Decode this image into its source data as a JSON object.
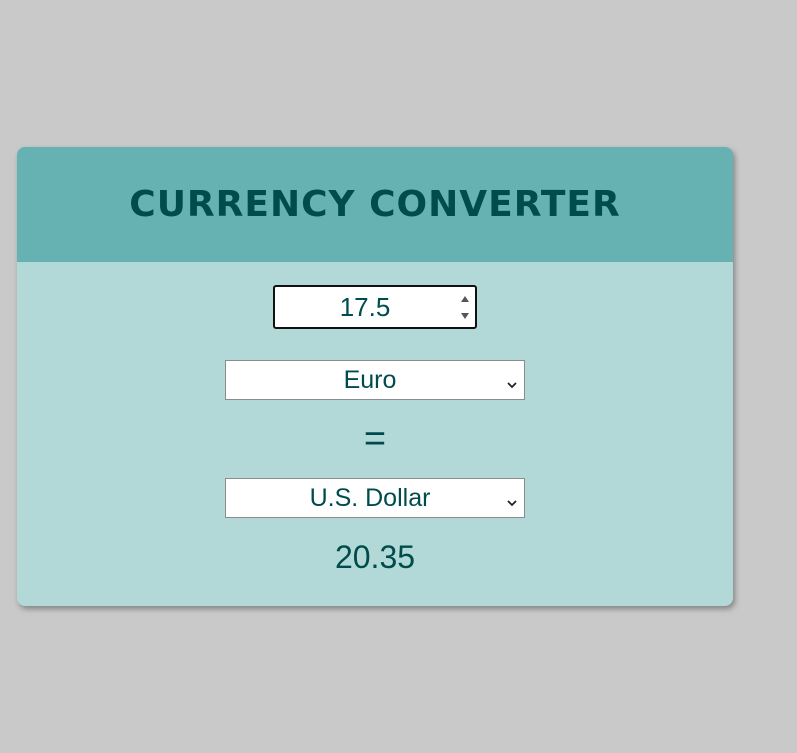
{
  "app": {
    "title": "CURRENCY CONVERTER"
  },
  "converter": {
    "amount": "17.5",
    "from_currency": "Euro",
    "equals_sign": "=",
    "to_currency": "U.S. Dollar",
    "result": "20.35"
  },
  "icons": {
    "spinner_up": "triangle-up-icon",
    "spinner_down": "triangle-down-icon",
    "dropdown": "chevron-down-icon"
  },
  "colors": {
    "page_background": "#c9c9c9",
    "header_background": "#66b2b2",
    "card_background": "#b2d9d8",
    "text": "#004c4c"
  }
}
